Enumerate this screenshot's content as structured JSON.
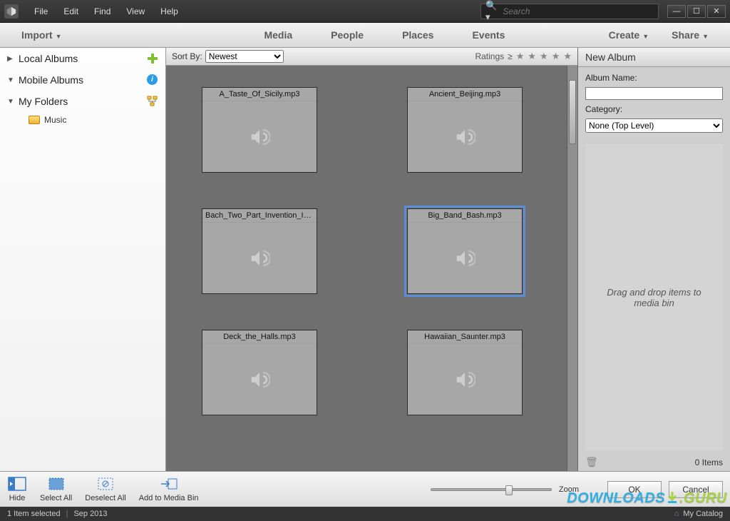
{
  "menu": {
    "items": [
      "File",
      "Edit",
      "Find",
      "View",
      "Help"
    ]
  },
  "search": {
    "placeholder": "Search"
  },
  "toolbar": {
    "import": "Import",
    "tabs": [
      "Media",
      "People",
      "Places",
      "Events"
    ],
    "create": "Create",
    "share": "Share"
  },
  "sidebar": {
    "items": [
      {
        "label": "Local Albums",
        "icon": "plus"
      },
      {
        "label": "Mobile Albums",
        "icon": "info"
      },
      {
        "label": "My Folders",
        "icon": "tree"
      }
    ],
    "sub": {
      "label": "Music"
    }
  },
  "sortbar": {
    "label": "Sort By:",
    "option": "Newest",
    "ratings_label": "Ratings",
    "gte": "≥"
  },
  "thumbs": [
    {
      "title": "A_Taste_Of_Sicily.mp3",
      "selected": false
    },
    {
      "title": "Ancient_Beijing.mp3",
      "selected": false
    },
    {
      "title": "Bach_Two_Part_Invention_In...",
      "selected": false
    },
    {
      "title": "Big_Band_Bash.mp3",
      "selected": true
    },
    {
      "title": "Deck_the_Halls.mp3",
      "selected": false
    },
    {
      "title": "Hawaiian_Saunter.mp3",
      "selected": false
    }
  ],
  "right_panel": {
    "title": "New Album",
    "name_label": "Album Name:",
    "name_value": "",
    "category_label": "Category:",
    "category_value": "None (Top Level)",
    "drop_hint": "Drag and drop items to media bin",
    "items_count": "0 Items"
  },
  "bottom": {
    "hide": "Hide",
    "select_all": "Select All",
    "deselect_all": "Deselect All",
    "add_to_bin": "Add to Media Bin",
    "zoom": "Zoom",
    "ok": "OK",
    "cancel": "Cancel"
  },
  "status": {
    "selected": "1 Item selected",
    "date": "Sep 2013",
    "catalog": "My Catalog"
  },
  "watermark": {
    "left": "DOWNLOADS",
    "right": ".GURU"
  }
}
